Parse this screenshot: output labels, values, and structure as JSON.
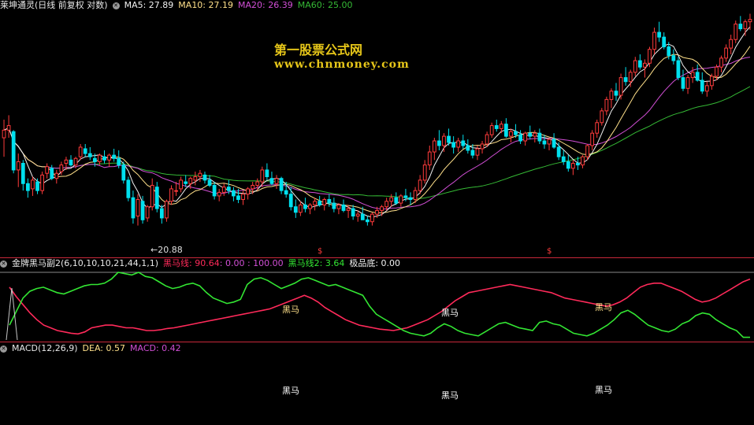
{
  "colors": {
    "up": "#ff3b3b",
    "down": "#00e0ee",
    "ma5": "#f2f2f2",
    "ma10": "#ffe08a",
    "ma20": "#d24fd6",
    "ma60": "#35b935",
    "red_line": "#ff2a5a",
    "green_line": "#33e633",
    "sep": "#c8283a"
  },
  "main_header": {
    "title": "莱坤通灵(日线 前复权 对数)",
    "ma5": "MA5: 27.89",
    "ma10": "MA10: 27.19",
    "ma20": "MA20: 26.39",
    "ma60": "MA60: 25.00"
  },
  "watermark": {
    "line1": "第一股票公式网",
    "line2": "www.chnmoney.com"
  },
  "annotations": {
    "low_label": "←20.88",
    "s_marks": [
      "$",
      "$"
    ]
  },
  "ind_header": {
    "title": "金牌黑马副2(6,10,10,10,21,44,1,1)",
    "red_label": "黑马线: 90.64",
    "mid": " : 0.00 : 100.00",
    "green_label": "黑马线2: 3.64",
    "base_label": "极品底: 0.00"
  },
  "macd_header": {
    "title": "MACD(12,26,9)",
    "dea": "DEA: 0.57",
    "macd": "MACD: 0.42"
  },
  "signal_labels": [
    "黑马",
    "黑马",
    "黑马"
  ],
  "chart_data": [
    {
      "type": "candlestick",
      "title": "莱坤通灵",
      "ylim": [
        19.5,
        35.5
      ],
      "log_scale": true,
      "low_marker": 20.88,
      "ma": {
        "MA5": 27.89,
        "MA10": 27.19,
        "MA20": 26.39,
        "MA60": 25.0
      },
      "candles": [
        [
          26.0,
          27.2,
          24.8,
          26.5
        ],
        [
          26.5,
          27.5,
          26.0,
          26.8
        ],
        [
          26.4,
          26.5,
          23.8,
          24.0
        ],
        [
          24.0,
          25.0,
          23.0,
          24.5
        ],
        [
          24.4,
          24.6,
          22.8,
          23.2
        ],
        [
          23.2,
          23.5,
          22.4,
          22.8
        ],
        [
          22.9,
          23.6,
          22.5,
          23.4
        ],
        [
          23.3,
          23.5,
          22.6,
          22.8
        ],
        [
          22.8,
          23.9,
          22.6,
          23.7
        ],
        [
          23.8,
          24.4,
          23.5,
          24.2
        ],
        [
          24.1,
          24.3,
          23.4,
          23.5
        ],
        [
          23.5,
          24.0,
          23.2,
          23.8
        ],
        [
          23.9,
          24.5,
          23.7,
          24.3
        ],
        [
          24.4,
          24.8,
          24.0,
          24.6
        ],
        [
          24.6,
          24.9,
          24.2,
          24.3
        ],
        [
          24.3,
          24.8,
          24.1,
          24.7
        ],
        [
          24.8,
          25.6,
          24.6,
          25.4
        ],
        [
          25.3,
          25.6,
          24.8,
          25.0
        ],
        [
          25.0,
          25.4,
          24.6,
          24.8
        ],
        [
          24.7,
          25.0,
          24.2,
          24.5
        ],
        [
          24.5,
          25.0,
          24.3,
          24.9
        ],
        [
          24.8,
          25.2,
          24.4,
          24.6
        ],
        [
          24.6,
          25.0,
          24.2,
          24.9
        ],
        [
          24.9,
          25.3,
          24.5,
          24.7
        ],
        [
          24.7,
          25.2,
          24.1,
          24.3
        ],
        [
          24.3,
          24.5,
          23.2,
          23.4
        ],
        [
          23.4,
          23.6,
          22.2,
          22.4
        ],
        [
          22.4,
          22.8,
          21.0,
          21.3
        ],
        [
          21.4,
          22.6,
          20.9,
          22.3
        ],
        [
          22.2,
          22.5,
          21.0,
          21.2
        ],
        [
          21.3,
          22.0,
          21.1,
          21.9
        ],
        [
          21.9,
          23.5,
          21.7,
          23.1
        ],
        [
          23.0,
          23.3,
          21.6,
          21.8
        ],
        [
          21.8,
          22.0,
          21.0,
          21.3
        ],
        [
          21.3,
          22.3,
          21.1,
          22.2
        ],
        [
          22.2,
          23.1,
          22.0,
          22.9
        ],
        [
          22.8,
          23.3,
          22.5,
          22.8
        ],
        [
          22.9,
          23.6,
          22.7,
          23.4
        ],
        [
          23.3,
          23.7,
          23.0,
          23.2
        ],
        [
          23.2,
          23.6,
          22.9,
          23.5
        ],
        [
          23.4,
          23.9,
          23.1,
          23.6
        ],
        [
          23.6,
          24.0,
          23.3,
          23.8
        ],
        [
          23.7,
          23.9,
          23.2,
          23.4
        ],
        [
          23.4,
          23.7,
          23.0,
          23.1
        ],
        [
          23.1,
          23.3,
          22.3,
          22.5
        ],
        [
          22.5,
          22.9,
          22.2,
          22.7
        ],
        [
          22.7,
          23.2,
          22.5,
          23.0
        ],
        [
          23.0,
          23.4,
          22.6,
          22.8
        ],
        [
          22.8,
          23.0,
          22.2,
          22.5
        ],
        [
          22.5,
          22.9,
          22.1,
          22.3
        ],
        [
          22.3,
          22.8,
          22.0,
          22.6
        ],
        [
          22.6,
          23.0,
          22.3,
          22.9
        ],
        [
          22.9,
          23.3,
          22.6,
          23.1
        ],
        [
          23.1,
          23.5,
          22.8,
          23.3
        ],
        [
          23.3,
          24.2,
          23.0,
          24.0
        ],
        [
          24.0,
          24.4,
          23.4,
          23.6
        ],
        [
          23.5,
          23.9,
          23.1,
          23.2
        ],
        [
          23.2,
          23.7,
          22.9,
          23.5
        ],
        [
          23.5,
          23.6,
          22.6,
          22.8
        ],
        [
          22.8,
          23.3,
          22.4,
          22.6
        ],
        [
          22.6,
          23.0,
          21.7,
          21.9
        ],
        [
          21.9,
          22.3,
          21.3,
          21.6
        ],
        [
          21.6,
          22.2,
          21.4,
          22.0
        ],
        [
          22.0,
          22.4,
          21.6,
          21.8
        ],
        [
          21.8,
          22.1,
          21.5,
          22.0
        ],
        [
          22.0,
          22.4,
          21.7,
          22.2
        ],
        [
          22.2,
          22.5,
          21.9,
          22.0
        ],
        [
          22.0,
          22.4,
          21.7,
          22.3
        ],
        [
          22.3,
          22.6,
          21.9,
          22.1
        ],
        [
          22.1,
          22.4,
          21.6,
          21.8
        ],
        [
          21.8,
          22.1,
          21.5,
          22.0
        ],
        [
          22.0,
          22.3,
          21.6,
          21.7
        ],
        [
          21.7,
          22.0,
          21.3,
          21.8
        ],
        [
          21.8,
          22.0,
          21.2,
          21.4
        ],
        [
          21.4,
          21.7,
          21.1,
          21.5
        ],
        [
          21.5,
          21.9,
          21.2,
          21.2
        ],
        [
          21.2,
          21.4,
          20.9,
          21.1
        ],
        [
          21.1,
          21.6,
          20.9,
          21.5
        ],
        [
          21.5,
          21.9,
          21.3,
          21.7
        ],
        [
          21.7,
          22.0,
          21.4,
          21.9
        ],
        [
          21.9,
          22.4,
          21.7,
          22.2
        ],
        [
          22.2,
          22.6,
          21.9,
          22.4
        ],
        [
          22.4,
          22.7,
          22.0,
          22.1
        ],
        [
          22.1,
          22.6,
          21.9,
          22.5
        ],
        [
          22.5,
          22.9,
          22.2,
          22.4
        ],
        [
          22.4,
          22.7,
          22.0,
          22.3
        ],
        [
          22.3,
          23.0,
          22.1,
          22.8
        ],
        [
          22.8,
          23.7,
          22.6,
          23.4
        ],
        [
          23.4,
          24.6,
          23.2,
          24.3
        ],
        [
          24.3,
          25.5,
          24.0,
          25.1
        ],
        [
          25.1,
          26.0,
          24.6,
          25.8
        ],
        [
          25.8,
          26.5,
          25.2,
          25.5
        ],
        [
          25.5,
          26.3,
          25.1,
          26.1
        ],
        [
          26.1,
          26.6,
          25.5,
          25.7
        ],
        [
          25.7,
          26.1,
          25.0,
          25.4
        ],
        [
          25.4,
          26.0,
          25.1,
          25.8
        ],
        [
          25.8,
          26.2,
          25.3,
          25.5
        ],
        [
          25.5,
          25.9,
          25.0,
          25.2
        ],
        [
          25.2,
          25.6,
          24.7,
          24.9
        ],
        [
          24.9,
          25.5,
          24.6,
          25.3
        ],
        [
          25.3,
          25.8,
          25.0,
          25.6
        ],
        [
          25.6,
          26.4,
          25.4,
          26.2
        ],
        [
          26.2,
          27.0,
          26.0,
          26.8
        ],
        [
          26.8,
          27.2,
          26.4,
          26.6
        ],
        [
          26.6,
          27.1,
          26.3,
          26.9
        ],
        [
          26.9,
          27.3,
          26.0,
          26.1
        ],
        [
          26.1,
          26.6,
          25.7,
          26.4
        ],
        [
          26.4,
          26.9,
          26.0,
          26.2
        ],
        [
          26.2,
          26.5,
          25.6,
          25.8
        ],
        [
          25.8,
          26.4,
          25.5,
          26.3
        ],
        [
          26.3,
          26.8,
          25.9,
          26.1
        ],
        [
          26.1,
          26.5,
          25.7,
          26.3
        ],
        [
          26.3,
          26.6,
          25.6,
          25.8
        ],
        [
          25.8,
          26.2,
          25.3,
          25.6
        ],
        [
          25.6,
          26.0,
          25.2,
          25.9
        ],
        [
          25.9,
          26.3,
          25.3,
          25.4
        ],
        [
          25.4,
          25.7,
          24.6,
          24.8
        ],
        [
          24.8,
          25.2,
          24.3,
          24.5
        ],
        [
          24.5,
          24.9,
          23.9,
          24.1
        ],
        [
          24.1,
          24.6,
          23.7,
          24.4
        ],
        [
          24.4,
          24.8,
          24.0,
          24.3
        ],
        [
          24.3,
          24.9,
          24.1,
          24.8
        ],
        [
          24.8,
          25.6,
          24.6,
          25.5
        ],
        [
          25.5,
          26.5,
          25.2,
          26.3
        ],
        [
          26.3,
          27.2,
          26.0,
          27.0
        ],
        [
          27.0,
          28.0,
          26.8,
          27.8
        ],
        [
          27.8,
          28.8,
          27.5,
          28.6
        ],
        [
          28.6,
          29.4,
          28.0,
          29.2
        ],
        [
          29.2,
          29.8,
          28.5,
          28.9
        ],
        [
          28.9,
          30.5,
          28.6,
          30.2
        ],
        [
          30.2,
          31.0,
          29.6,
          29.9
        ],
        [
          29.9,
          30.8,
          29.5,
          30.6
        ],
        [
          30.6,
          31.8,
          30.3,
          31.5
        ],
        [
          31.5,
          32.0,
          30.8,
          31.0
        ],
        [
          31.0,
          31.6,
          30.2,
          31.3
        ],
        [
          31.3,
          32.6,
          31.0,
          32.4
        ],
        [
          32.4,
          34.2,
          32.0,
          33.8
        ],
        [
          33.8,
          34.7,
          33.0,
          33.4
        ],
        [
          33.4,
          33.8,
          32.4,
          32.6
        ],
        [
          32.6,
          33.0,
          31.6,
          31.9
        ],
        [
          31.9,
          32.4,
          31.2,
          31.5
        ],
        [
          31.5,
          31.8,
          30.0,
          30.2
        ],
        [
          30.2,
          30.8,
          29.2,
          29.4
        ],
        [
          29.4,
          30.4,
          29.0,
          30.2
        ],
        [
          30.2,
          31.0,
          29.8,
          30.6
        ],
        [
          30.6,
          31.2,
          29.9,
          30.0
        ],
        [
          30.0,
          30.6,
          29.0,
          29.2
        ],
        [
          29.2,
          29.9,
          28.8,
          29.6
        ],
        [
          29.6,
          30.5,
          29.3,
          30.3
        ],
        [
          30.3,
          31.2,
          30.0,
          31.0
        ],
        [
          31.0,
          31.9,
          30.6,
          31.7
        ],
        [
          31.7,
          32.8,
          31.4,
          32.5
        ],
        [
          32.5,
          33.6,
          32.0,
          33.2
        ],
        [
          33.2,
          34.8,
          32.9,
          34.5
        ],
        [
          34.5,
          35.2,
          33.9,
          34.1
        ],
        [
          34.1,
          34.9,
          33.5,
          34.7
        ],
        [
          34.7,
          35.4,
          34.0,
          34.9
        ]
      ]
    },
    {
      "type": "line",
      "title": "金牌黑马副2(6,10,10,10,21,44,1,1)",
      "ylim": [
        0,
        100
      ],
      "series": [
        {
          "name": "黑马线",
          "values": [
            78,
            64,
            52,
            40,
            30,
            22,
            18,
            14,
            12,
            10,
            9,
            12,
            18,
            20,
            22,
            22,
            20,
            18,
            18,
            16,
            14,
            14,
            15,
            17,
            18,
            20,
            22,
            24,
            26,
            28,
            30,
            32,
            34,
            36,
            38,
            40,
            42,
            44,
            46,
            50,
            54,
            58,
            62,
            66,
            62,
            56,
            48,
            42,
            36,
            30,
            26,
            22,
            20,
            18,
            16,
            15,
            14,
            16,
            18,
            22,
            26,
            30,
            36,
            42,
            50,
            58,
            64,
            70,
            72,
            74,
            76,
            78,
            80,
            82,
            80,
            78,
            76,
            74,
            72,
            70,
            66,
            62,
            60,
            58,
            56,
            54,
            52,
            50,
            52,
            56,
            62,
            70,
            78,
            82,
            84,
            84,
            80,
            76,
            72,
            66,
            60,
            56,
            58,
            62,
            68,
            74,
            80,
            86,
            90
          ]
        },
        {
          "name": "黑马线2",
          "values": [
            22,
            42,
            62,
            72,
            76,
            78,
            74,
            70,
            68,
            72,
            76,
            80,
            82,
            82,
            84,
            90,
            100,
            98,
            96,
            100,
            94,
            92,
            86,
            80,
            76,
            78,
            82,
            84,
            80,
            70,
            62,
            58,
            54,
            56,
            60,
            82,
            90,
            92,
            88,
            82,
            76,
            80,
            84,
            90,
            92,
            88,
            84,
            80,
            82,
            78,
            74,
            70,
            66,
            50,
            38,
            32,
            26,
            20,
            14,
            10,
            8,
            6,
            10,
            18,
            24,
            20,
            14,
            10,
            8,
            6,
            12,
            18,
            24,
            26,
            22,
            18,
            16,
            14,
            26,
            28,
            24,
            22,
            16,
            10,
            8,
            6,
            10,
            16,
            22,
            30,
            40,
            44,
            38,
            30,
            22,
            18,
            14,
            12,
            16,
            24,
            28,
            36,
            40,
            38,
            30,
            24,
            18,
            14,
            4,
            4
          ]
        }
      ]
    }
  ]
}
